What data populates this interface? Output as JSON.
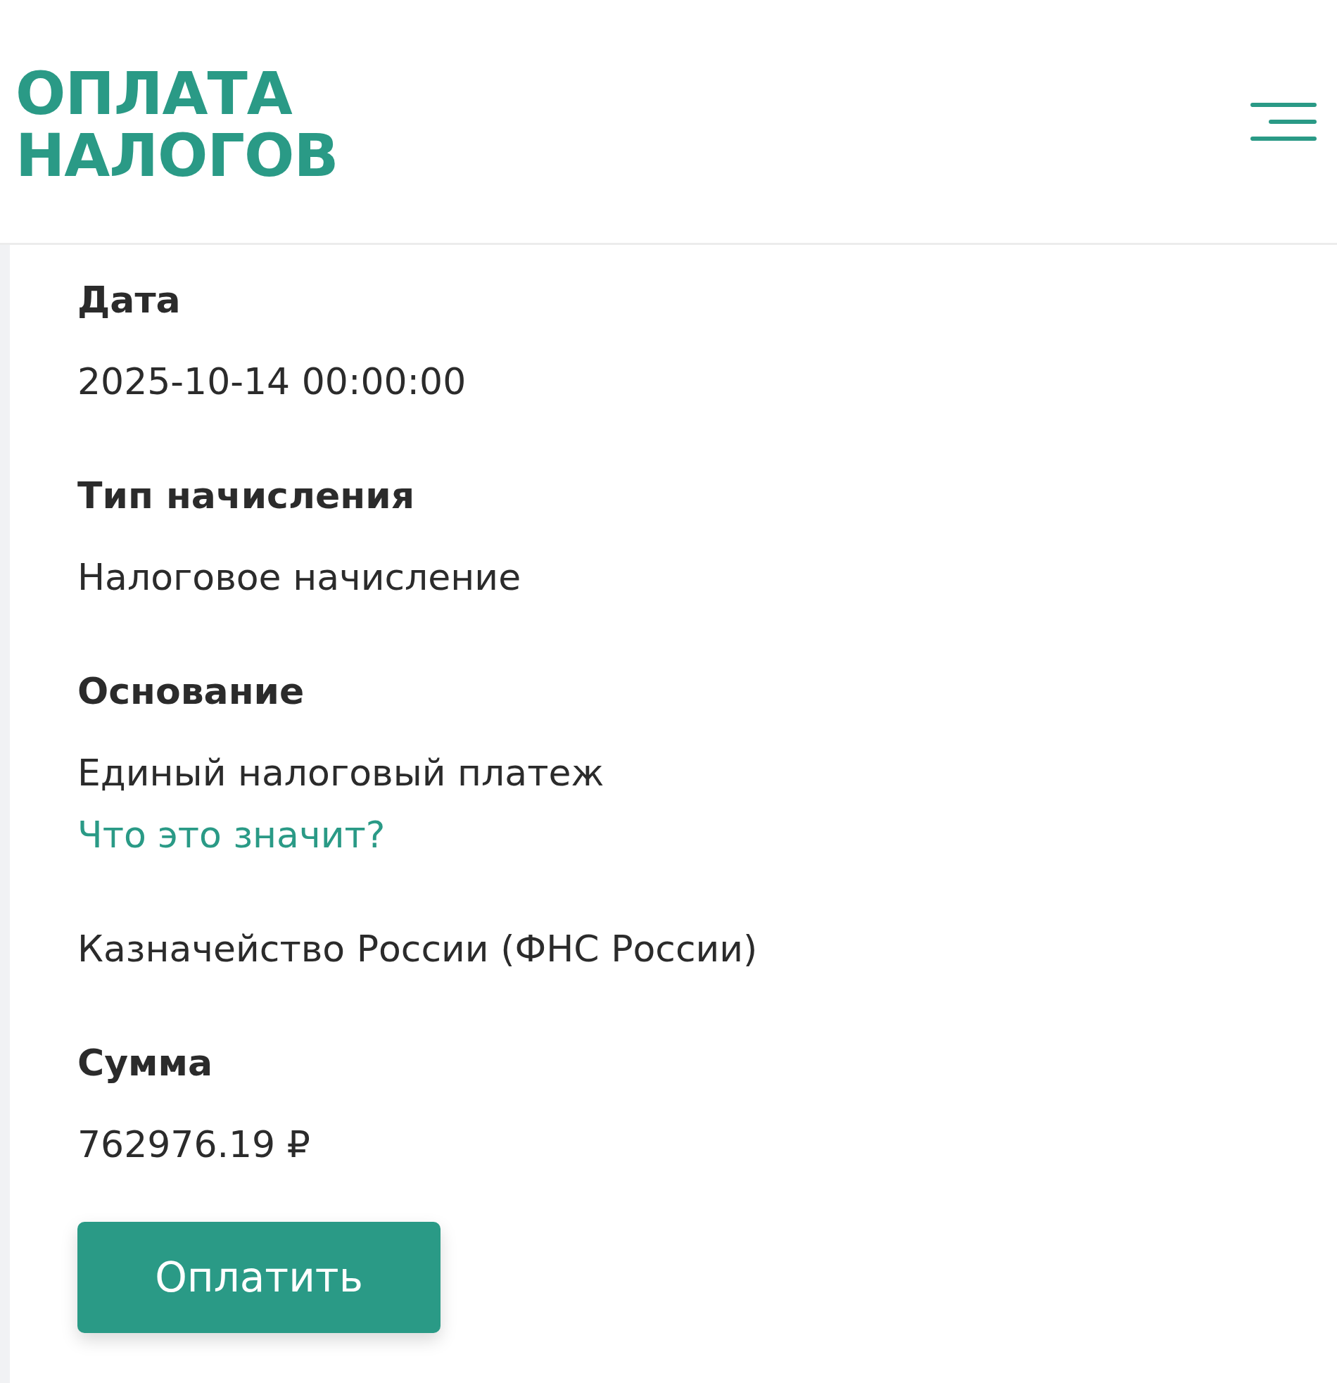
{
  "header": {
    "title_lines": [
      "ОПЛАТА",
      "НАЛОГОВ"
    ]
  },
  "fields": [
    {
      "label": "Дата",
      "value": "2025-10-14 00:00:00"
    },
    {
      "label": "Тип начисления",
      "value": "Налоговое начисление"
    },
    {
      "label": "Основание",
      "value": "Единый налоговый платеж",
      "link": "Что это значит?"
    },
    {
      "value": "Казначейство России (ФНС России)"
    },
    {
      "label": "Сумма",
      "value": "762976.19 ₽"
    }
  ],
  "pay_button": "Оплатить"
}
